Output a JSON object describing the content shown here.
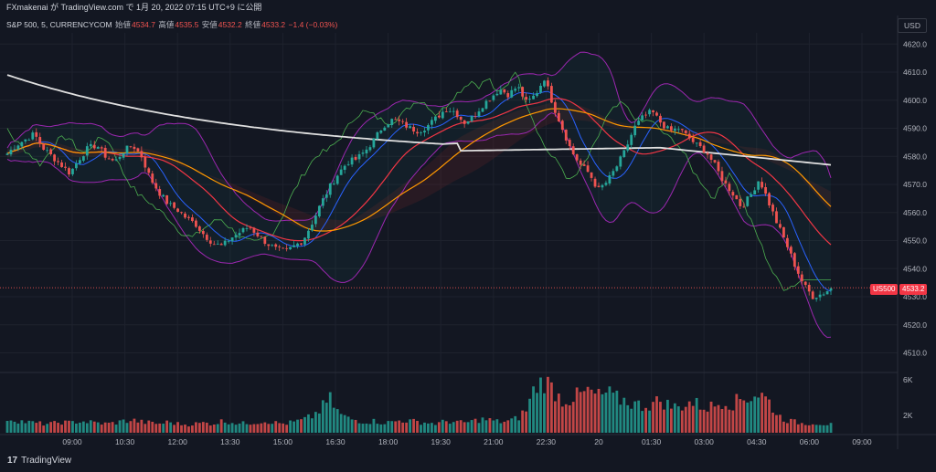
{
  "header": {
    "publish_line": "FXmakenai が TradingView.com で 1月 20, 2022 07:15 UTC+9 に公開"
  },
  "legend": {
    "symbol": "S&P 500, 5, CURRENCYCOM",
    "open_label": "始値",
    "open_value": "4534.7",
    "high_label": "高値",
    "high_value": "4535.5",
    "low_label": "安値",
    "low_value": "4532.2",
    "close_label": "終値",
    "close_value": "4533.2",
    "change": "−1.4 (−0.03%)"
  },
  "currency": "USD",
  "badges": {
    "symbol_badge": "US500",
    "price_badge": "4533.2"
  },
  "footer": {
    "brand": "TradingView",
    "logo_glyph": "17"
  },
  "colors": {
    "up": "#26a69a",
    "down": "#ef5350",
    "background": "#131722",
    "bb": "#9c27b0",
    "sma": "#e0e0e0"
  },
  "chart_data": {
    "type": "candlestick",
    "price_axis": {
      "ticks": [
        "4620.0",
        "4610.0",
        "4600.0",
        "4590.0",
        "4580.0",
        "4570.0",
        "4560.0",
        "4550.0",
        "4540.0",
        "4530.0",
        "4520.0",
        "4510.0"
      ],
      "ylim": [
        4504,
        4624
      ]
    },
    "volume_axis": {
      "ticks": [
        "6K",
        "2K"
      ]
    },
    "time_axis": [
      "09:00",
      "10:30",
      "12:00",
      "13:30",
      "15:00",
      "16:30",
      "18:00",
      "19:30",
      "21:00",
      "22:30",
      "20",
      "01:30",
      "03:00",
      "04:30",
      "06:00",
      "09:00"
    ],
    "last_price": 4533.2,
    "close_path": [
      4581,
      4584,
      4586,
      4588,
      4583,
      4580,
      4577,
      4574,
      4579,
      4583,
      4584,
      4580,
      4578,
      4582,
      4584,
      4580,
      4572,
      4567,
      4563,
      4561,
      4558,
      4556,
      4552,
      4549,
      4548,
      4551,
      4553,
      4555,
      4552,
      4549,
      4547,
      4546,
      4548,
      4550,
      4556,
      4563,
      4569,
      4574,
      4578,
      4579,
      4582,
      4586,
      4591,
      4593,
      4592,
      4590,
      4589,
      4591,
      4594,
      4597,
      4596,
      4592,
      4594,
      4598,
      4601,
      4604,
      4602,
      4605,
      4599,
      4602,
      4608,
      4598,
      4590,
      4582,
      4577,
      4574,
      4568,
      4571,
      4576,
      4582,
      4590,
      4594,
      4596,
      4592,
      4589,
      4590,
      4587,
      4584,
      4582,
      4577,
      4571,
      4567,
      4562,
      4566,
      4572,
      4564,
      4556,
      4549,
      4541,
      4534,
      4530,
      4531,
      4533
    ],
    "volume_path": [
      1.6,
      1.4,
      1.2,
      1.1,
      1.0,
      1.0,
      1.2,
      1.1,
      1.3,
      1.2,
      1.1,
      1.0,
      1.1,
      1.3,
      1.4,
      1.2,
      1.1,
      1.0,
      1.2,
      1.0,
      0.9,
      1.0,
      1.1,
      1.0,
      1.3,
      1.2,
      1.0,
      1.1,
      1.2,
      1.3,
      1.1,
      1.0,
      1.2,
      1.4,
      1.8,
      2.6,
      3.8,
      2.2,
      1.6,
      1.4,
      1.2,
      1.3,
      1.1,
      1.2,
      1.4,
      1.3,
      1.2,
      1.1,
      1.0,
      1.3,
      1.2,
      1.1,
      1.3,
      1.5,
      1.4,
      1.2,
      1.3,
      1.6,
      2.6,
      5.2,
      5.8,
      4.8,
      3.6,
      3.8,
      4.2,
      4.6,
      4.0,
      4.4,
      3.8,
      3.6,
      3.2,
      3.0,
      3.2,
      3.6,
      3.0,
      2.8,
      3.4,
      3.2,
      2.8,
      3.0,
      3.6,
      3.2,
      3.8,
      4.0,
      4.4,
      3.6,
      2.0,
      1.4,
      1.2,
      1.0,
      1.1,
      1.0,
      0.9
    ]
  }
}
